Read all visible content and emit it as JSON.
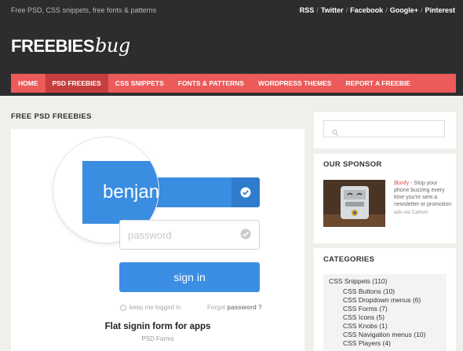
{
  "topbar": {
    "tagline": "Free PSD, CSS snippets, free fonts & patterns",
    "social": [
      "RSS",
      "Twitter",
      "Facebook",
      "Google+",
      "Pinterest"
    ],
    "separator": "/"
  },
  "logo": {
    "main": "FREEBIES",
    "script": "bug"
  },
  "nav": {
    "items": [
      "Home",
      "PSD Freebies",
      "CSS Snippets",
      "Fonts & Patterns",
      "WordPress Themes",
      "Report a Freebie"
    ],
    "active_index": 1
  },
  "main": {
    "section_title": "FREE PSD FREEBIES",
    "preview": {
      "username_zoom_text": "benjan",
      "password_placeholder": "password",
      "signin_label": "sign in",
      "keep_logged": "keep me logged in",
      "forgot_prefix": "Forgot",
      "forgot_bold": "password ?"
    },
    "post_title": "Flat signin form for apps",
    "post_category": "PSD Forms"
  },
  "sidebar": {
    "sponsor_title": "OUR SPONSOR",
    "sponsor_price": "$body",
    "sponsor_text": "- Stop your phone buzzing every time you're sent a newsletter or promotion",
    "ads_via": "ads via Carbon",
    "categories_title": "CATEGORIES",
    "categories": [
      {
        "label": "CSS Snippets (110)",
        "level": 0
      },
      {
        "label": "CSS Buttons (10)",
        "level": 1
      },
      {
        "label": "CSS Dropdown menus (6)",
        "level": 1
      },
      {
        "label": "CSS Forms (7)",
        "level": 1
      },
      {
        "label": "CSS Icons (5)",
        "level": 1
      },
      {
        "label": "CSS Knobs (1)",
        "level": 1
      },
      {
        "label": "CSS Navigation menus (10)",
        "level": 1
      },
      {
        "label": "CSS Players (4)",
        "level": 1
      }
    ]
  },
  "colors": {
    "dark_bg": "#2d2d2f",
    "nav_red": "#ec5a5a",
    "nav_active": "#c73e3e",
    "form_blue": "#3a8de0",
    "page_bg": "#f0efec"
  }
}
